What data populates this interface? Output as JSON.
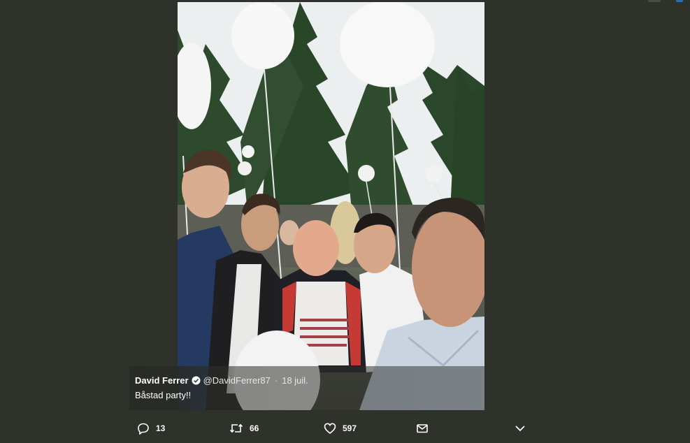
{
  "tweet": {
    "author_name": "David Ferrer",
    "verified_icon": "verified-badge-icon",
    "handle": "@DavidFerrer87",
    "separator": "·",
    "date": "18 juil.",
    "text": "Båstad party!!"
  },
  "photo": {
    "description_icon": "photo-image"
  },
  "actions": {
    "reply_count": "13",
    "retweet_count": "66",
    "like_count": "597"
  },
  "colors": {
    "background": "#2f312b",
    "text": "#ffffff"
  }
}
